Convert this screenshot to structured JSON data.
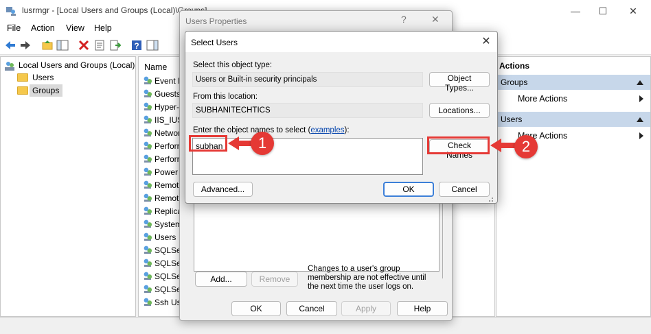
{
  "main_window": {
    "title": "lusrmgr - [Local Users and Groups (Local)\\Groups]",
    "controls": {
      "minimize": "—",
      "maximize": "☐",
      "close": "✕"
    }
  },
  "menu": [
    "File",
    "Action",
    "View",
    "Help"
  ],
  "tree": {
    "root": "Local Users and Groups (Local)",
    "children": [
      "Users",
      "Groups"
    ]
  },
  "list": {
    "header": "Name",
    "rows": [
      "Event L",
      "Guests",
      "Hyper-",
      "IIS_IUSI",
      "Networ",
      "Perforr",
      "Perforr",
      "Power",
      "Remote",
      "Remote",
      "Replica",
      "System",
      "Users",
      "SQLSer",
      "SQLSer",
      "SQLSer",
      "SQLSer",
      "Ssh Use"
    ]
  },
  "actions": {
    "header": "Actions",
    "sections": [
      {
        "title": "Groups",
        "item": "More Actions"
      },
      {
        "title": "Users",
        "item": "More Actions"
      }
    ]
  },
  "properties_dialog": {
    "title": "Users Properties",
    "help_glyph": "?",
    "close_glyph": "✕",
    "add_label": "Add...",
    "remove_label": "Remove",
    "note": "Changes to a user's group membership are not effective until the next time the user logs on.",
    "ok_label": "OK",
    "cancel_label": "Cancel",
    "apply_label": "Apply",
    "help_label": "Help"
  },
  "select_dialog": {
    "title": "Select Users",
    "close_glyph": "✕",
    "object_type_label": "Select this object type:",
    "object_type_value": "Users or Built-in security principals",
    "object_types_button": "Object Types...",
    "location_label": "From this location:",
    "location_value": "SUBHANITECHTICS",
    "locations_button": "Locations...",
    "enter_names_label_prefix": "Enter the object names to select (",
    "examples_link": "examples",
    "enter_names_label_suffix": "):",
    "input_value": "subhan",
    "check_names_button": "Check Names",
    "advanced_button": "Advanced...",
    "ok_button": "OK",
    "cancel_button": "Cancel"
  },
  "annotations": {
    "step1": "1",
    "step2": "2",
    "color": "#e53935"
  }
}
